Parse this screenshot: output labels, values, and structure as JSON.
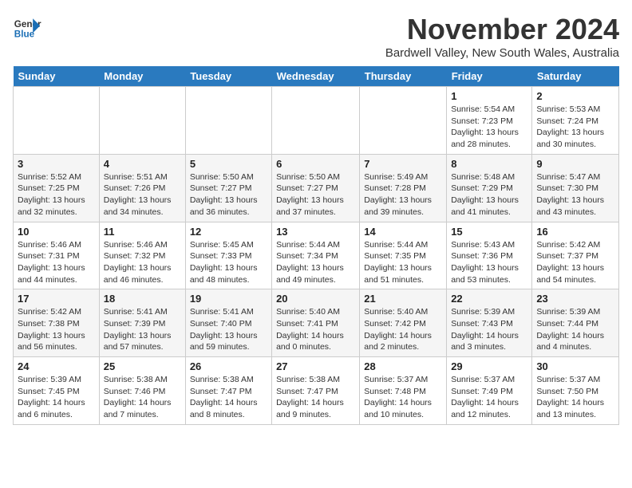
{
  "header": {
    "logo_line1": "General",
    "logo_line2": "Blue",
    "month_title": "November 2024",
    "subtitle": "Bardwell Valley, New South Wales, Australia"
  },
  "weekdays": [
    "Sunday",
    "Monday",
    "Tuesday",
    "Wednesday",
    "Thursday",
    "Friday",
    "Saturday"
  ],
  "weeks": [
    [
      {
        "day": "",
        "detail": ""
      },
      {
        "day": "",
        "detail": ""
      },
      {
        "day": "",
        "detail": ""
      },
      {
        "day": "",
        "detail": ""
      },
      {
        "day": "",
        "detail": ""
      },
      {
        "day": "1",
        "detail": "Sunrise: 5:54 AM\nSunset: 7:23 PM\nDaylight: 13 hours and 28 minutes."
      },
      {
        "day": "2",
        "detail": "Sunrise: 5:53 AM\nSunset: 7:24 PM\nDaylight: 13 hours and 30 minutes."
      }
    ],
    [
      {
        "day": "3",
        "detail": "Sunrise: 5:52 AM\nSunset: 7:25 PM\nDaylight: 13 hours and 32 minutes."
      },
      {
        "day": "4",
        "detail": "Sunrise: 5:51 AM\nSunset: 7:26 PM\nDaylight: 13 hours and 34 minutes."
      },
      {
        "day": "5",
        "detail": "Sunrise: 5:50 AM\nSunset: 7:27 PM\nDaylight: 13 hours and 36 minutes."
      },
      {
        "day": "6",
        "detail": "Sunrise: 5:50 AM\nSunset: 7:27 PM\nDaylight: 13 hours and 37 minutes."
      },
      {
        "day": "7",
        "detail": "Sunrise: 5:49 AM\nSunset: 7:28 PM\nDaylight: 13 hours and 39 minutes."
      },
      {
        "day": "8",
        "detail": "Sunrise: 5:48 AM\nSunset: 7:29 PM\nDaylight: 13 hours and 41 minutes."
      },
      {
        "day": "9",
        "detail": "Sunrise: 5:47 AM\nSunset: 7:30 PM\nDaylight: 13 hours and 43 minutes."
      }
    ],
    [
      {
        "day": "10",
        "detail": "Sunrise: 5:46 AM\nSunset: 7:31 PM\nDaylight: 13 hours and 44 minutes."
      },
      {
        "day": "11",
        "detail": "Sunrise: 5:46 AM\nSunset: 7:32 PM\nDaylight: 13 hours and 46 minutes."
      },
      {
        "day": "12",
        "detail": "Sunrise: 5:45 AM\nSunset: 7:33 PM\nDaylight: 13 hours and 48 minutes."
      },
      {
        "day": "13",
        "detail": "Sunrise: 5:44 AM\nSunset: 7:34 PM\nDaylight: 13 hours and 49 minutes."
      },
      {
        "day": "14",
        "detail": "Sunrise: 5:44 AM\nSunset: 7:35 PM\nDaylight: 13 hours and 51 minutes."
      },
      {
        "day": "15",
        "detail": "Sunrise: 5:43 AM\nSunset: 7:36 PM\nDaylight: 13 hours and 53 minutes."
      },
      {
        "day": "16",
        "detail": "Sunrise: 5:42 AM\nSunset: 7:37 PM\nDaylight: 13 hours and 54 minutes."
      }
    ],
    [
      {
        "day": "17",
        "detail": "Sunrise: 5:42 AM\nSunset: 7:38 PM\nDaylight: 13 hours and 56 minutes."
      },
      {
        "day": "18",
        "detail": "Sunrise: 5:41 AM\nSunset: 7:39 PM\nDaylight: 13 hours and 57 minutes."
      },
      {
        "day": "19",
        "detail": "Sunrise: 5:41 AM\nSunset: 7:40 PM\nDaylight: 13 hours and 59 minutes."
      },
      {
        "day": "20",
        "detail": "Sunrise: 5:40 AM\nSunset: 7:41 PM\nDaylight: 14 hours and 0 minutes."
      },
      {
        "day": "21",
        "detail": "Sunrise: 5:40 AM\nSunset: 7:42 PM\nDaylight: 14 hours and 2 minutes."
      },
      {
        "day": "22",
        "detail": "Sunrise: 5:39 AM\nSunset: 7:43 PM\nDaylight: 14 hours and 3 minutes."
      },
      {
        "day": "23",
        "detail": "Sunrise: 5:39 AM\nSunset: 7:44 PM\nDaylight: 14 hours and 4 minutes."
      }
    ],
    [
      {
        "day": "24",
        "detail": "Sunrise: 5:39 AM\nSunset: 7:45 PM\nDaylight: 14 hours and 6 minutes."
      },
      {
        "day": "25",
        "detail": "Sunrise: 5:38 AM\nSunset: 7:46 PM\nDaylight: 14 hours and 7 minutes."
      },
      {
        "day": "26",
        "detail": "Sunrise: 5:38 AM\nSunset: 7:47 PM\nDaylight: 14 hours and 8 minutes."
      },
      {
        "day": "27",
        "detail": "Sunrise: 5:38 AM\nSunset: 7:47 PM\nDaylight: 14 hours and 9 minutes."
      },
      {
        "day": "28",
        "detail": "Sunrise: 5:37 AM\nSunset: 7:48 PM\nDaylight: 14 hours and 10 minutes."
      },
      {
        "day": "29",
        "detail": "Sunrise: 5:37 AM\nSunset: 7:49 PM\nDaylight: 14 hours and 12 minutes."
      },
      {
        "day": "30",
        "detail": "Sunrise: 5:37 AM\nSunset: 7:50 PM\nDaylight: 14 hours and 13 minutes."
      }
    ]
  ]
}
